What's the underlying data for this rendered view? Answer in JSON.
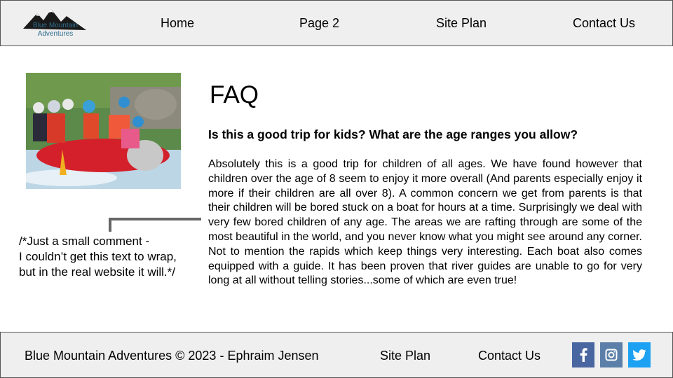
{
  "logo": {
    "text": "Blue Mountain Adventures"
  },
  "nav": {
    "home": "Home",
    "page2": "Page 2",
    "site_plan": "Site Plan",
    "contact": "Contact Us"
  },
  "comment": {
    "line1": "/*Just a small comment -",
    "line2": "I couldn’t get this text to wrap,",
    "line3": "but in the real website it will.*/"
  },
  "faq": {
    "title": "FAQ",
    "question": "Is this a good trip for kids? What are the age ranges you allow?",
    "answer": "Absolutely this is a good trip for children of all ages. We have found however that children over the age of 8 seem to enjoy it more overall (And parents especially enjoy it more if their children are all over 8). A common concern we get from parents is that their children will be bored stuck on a boat for hours at a time. Surprisingly we deal with very few bored children of any age. The areas we are rafting through are some of the most beautiful in the world, and you never know what you might see around any corner. Not to mention the rapids which keep things very interesting. Each boat also comes equipped with a guide. It has been proven that river guides are unable to go for very long at all without telling stories...some of which are even true!"
  },
  "footer": {
    "copyright": "Blue Mountain Adventures © 2023 - Ephraim Jensen",
    "site_plan": "Site Plan",
    "contact": "Contact Us"
  },
  "social": [
    {
      "icon": "facebook-icon",
      "color": "#4a66a0"
    },
    {
      "icon": "instagram-icon",
      "color": "#5b7fa8"
    },
    {
      "icon": "twitter-icon",
      "color": "#1da1f2"
    }
  ],
  "colors": {
    "header_bg": "#efefef",
    "logo_text": "#2f6d8f",
    "comment_line": "#666666"
  }
}
